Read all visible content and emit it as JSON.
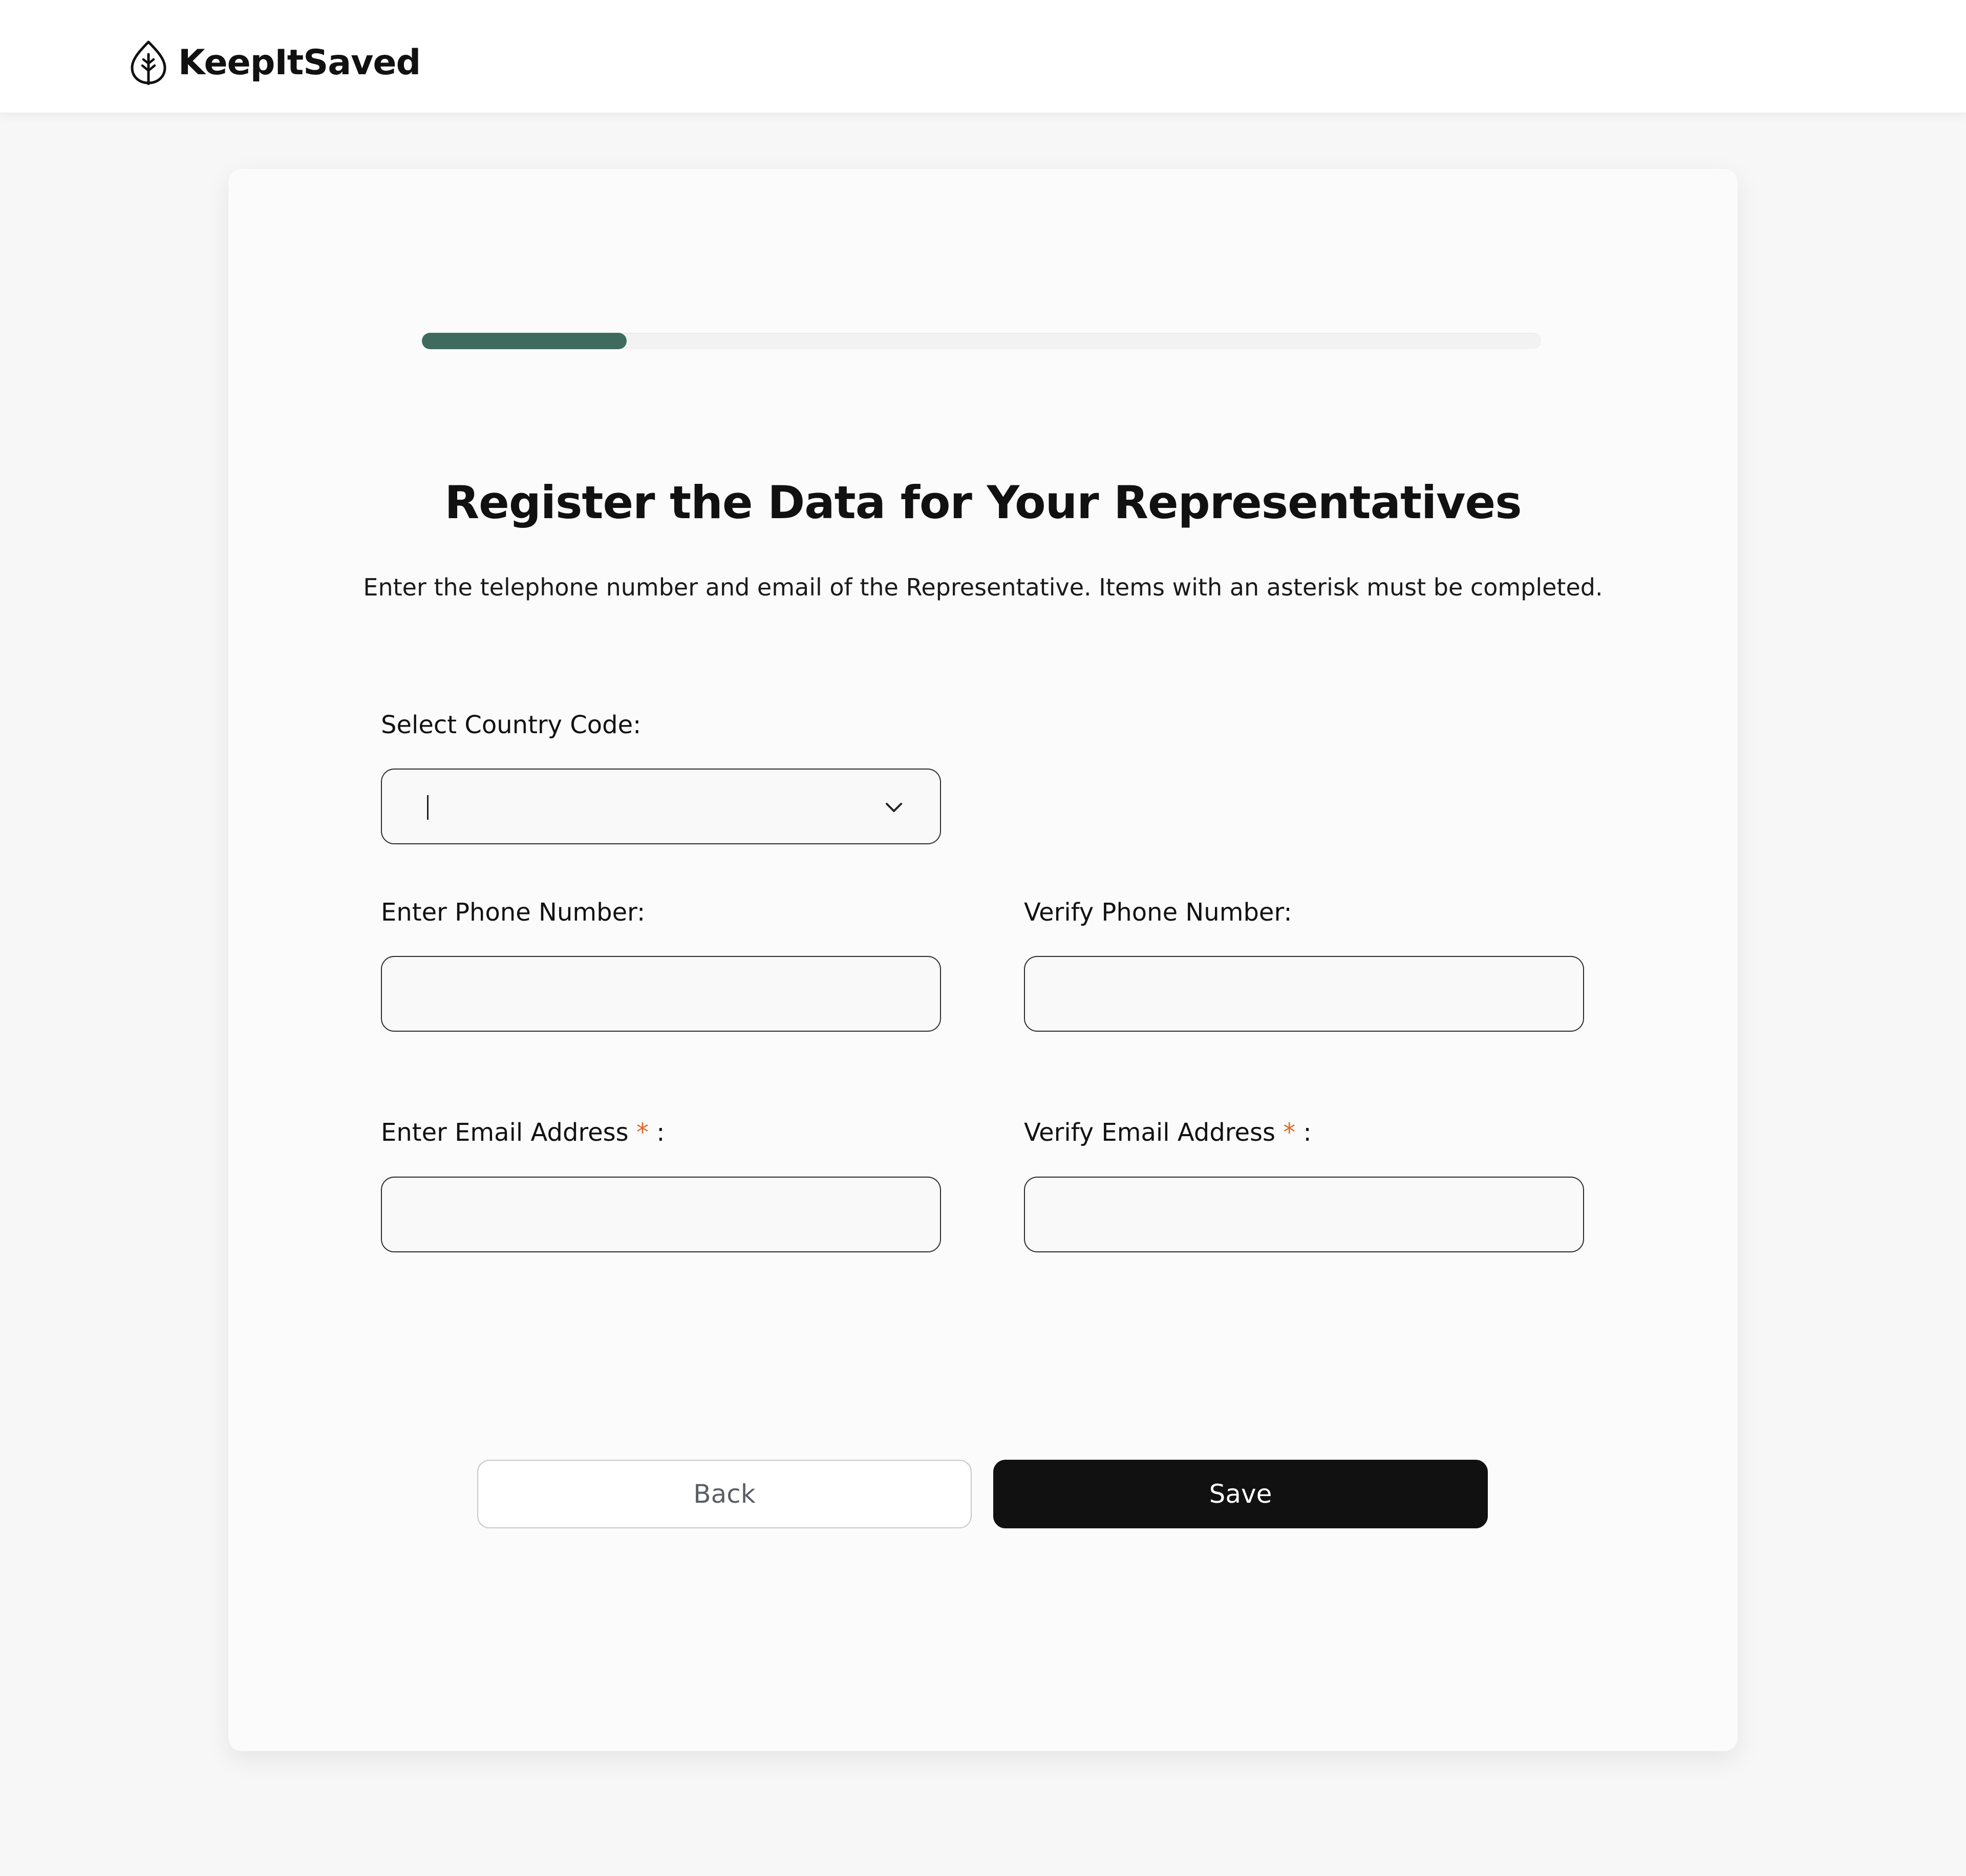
{
  "brand": {
    "name": "KeepItSaved",
    "icon": "leaf-icon"
  },
  "progress": {
    "percent": 18.3,
    "color": "#3e6b5e"
  },
  "page": {
    "title": "Register the Data for Your Representatives",
    "subtitle": "Enter the telephone number and email of the Representative. Items with an asterisk must be completed."
  },
  "form": {
    "country_code": {
      "label": "Select Country Code:",
      "value": "",
      "icon": "chevron-down-icon"
    },
    "phone": {
      "label": "Enter Phone Number:",
      "value": ""
    },
    "verify_phone": {
      "label": "Verify Phone Number:",
      "value": ""
    },
    "email": {
      "label": "Enter Email Address",
      "required_mark": "*",
      "suffix": ":",
      "value": ""
    },
    "verify_email": {
      "label": "Verify Email Address",
      "required_mark": "*",
      "suffix": ":",
      "value": ""
    }
  },
  "buttons": {
    "back": "Back",
    "save": "Save"
  },
  "colors": {
    "accent": "#3e6b5e",
    "required": "#e06a2c",
    "primary_button": "#111111"
  }
}
